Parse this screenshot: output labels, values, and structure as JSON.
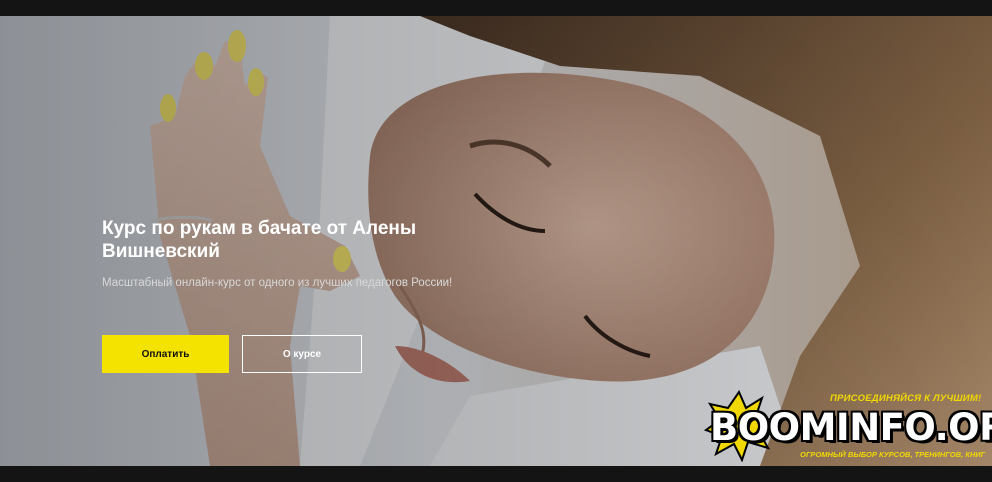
{
  "hero": {
    "title": "Курс по рукам в бачате от Алены Вишневский",
    "subtitle": "Масштабный онлайн-курс от одного из лучших педагогов России!",
    "pay_button": "Оплатить",
    "about_button": "О курсе"
  },
  "watermark": {
    "tagline_top": "ПРИСОЕДИНЯЙСЯ К ЛУЧШИМ!",
    "logo": "BOOMINFO.ORG",
    "tagline_bottom": "ОГРОМНЫЙ ВЫБОР КУРСОВ, ТРЕНИНГОВ, КНИГ"
  },
  "colors": {
    "accent": "#f4e200",
    "background": "#141414"
  }
}
